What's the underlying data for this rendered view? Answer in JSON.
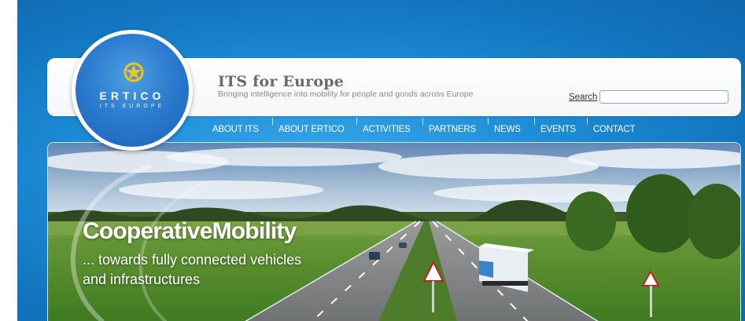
{
  "logo": {
    "wordmark": "ERTICO",
    "subline": "ITS EUROPE",
    "emblem_icon": "globe-star-icon"
  },
  "header": {
    "title": "ITS for Europe",
    "tagline": "Bringing intelligence into mobility for people and goods across Europe"
  },
  "search": {
    "label": "Search",
    "value": "",
    "placeholder": ""
  },
  "nav": {
    "items": [
      {
        "label": "ABOUT ITS"
      },
      {
        "label": "ABOUT ERTICO"
      },
      {
        "label": "ACTIVITIES"
      },
      {
        "label": "PARTNERS"
      },
      {
        "label": "NEWS"
      },
      {
        "label": "EVENTS"
      },
      {
        "label": "CONTACT"
      }
    ]
  },
  "banner": {
    "headline": "CooperativeMobility",
    "subline_1": "... towards fully connected vehicles",
    "subline_2": "and infrastructures"
  },
  "colors": {
    "page_background": "#1f8ed8",
    "header_title": "#6b6b6b",
    "logo_fill": "#2c7cd0",
    "logo_emblem": "#f2c21b",
    "nav_text": "#ffffff"
  }
}
